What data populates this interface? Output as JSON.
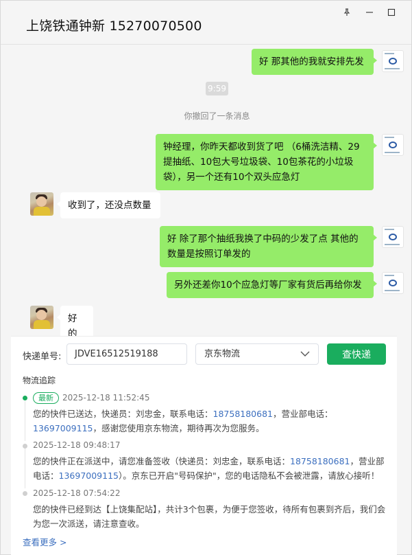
{
  "window": {
    "title": "上饶铁通钟新 15270070500",
    "controls": [
      "pin-icon",
      "minimize-icon",
      "maximize-icon"
    ]
  },
  "chat": {
    "time_chip": "9:59",
    "recall_notice": "你撤回了一条消息",
    "messages": [
      {
        "from": "me",
        "lines": [
          "好 那其他的我就安排先发"
        ]
      },
      {
        "from": "me",
        "lines": [
          "钟经理，你昨天都收到货了吧 （6桶洗洁精、29",
          "提抽纸、10包大号垃圾袋、10包茶花的小垃圾",
          "袋），另一个还有10个双头应急灯"
        ]
      },
      {
        "from": "other",
        "lines": [
          "收到了，还没点数量"
        ]
      },
      {
        "from": "me",
        "lines": [
          "好  除了那个抽纸我换了中码的少发了点 其他的",
          "数量是按照订单发的"
        ]
      },
      {
        "from": "me",
        "lines": [
          "另外还差你10个应急灯等厂家有货后再给你发"
        ]
      },
      {
        "from": "other",
        "lines": [
          "好的"
        ]
      }
    ]
  },
  "tracking": {
    "label_no": "快递单号:",
    "tracking_no": "JDVE16512519188",
    "carrier": "京东物流",
    "query_button": "查快递",
    "section_title": "物流追踪",
    "events": [
      {
        "badge": "最新",
        "time": "2025-12-18 11:52:45",
        "parts": [
          {
            "t": "您的快件已送达，快递员：刘忠金，联系电话：",
            "tel": false
          },
          {
            "t": "18758180681",
            "tel": true
          },
          {
            "t": "，营业部电话：",
            "tel": false
          },
          {
            "t": "13697009115",
            "tel": true
          },
          {
            "t": "，感谢您使用京东物流，期待再次为您服务。",
            "tel": false
          }
        ]
      },
      {
        "badge": "",
        "time": "2025-12-18 09:48:17",
        "parts": [
          {
            "t": "您的快件正在派送中，请您准备签收（快递员：刘忠金，联系电话：",
            "tel": false
          },
          {
            "t": "18758180681",
            "tel": true
          },
          {
            "t": "，营业部电话：",
            "tel": false
          },
          {
            "t": "13697009115",
            "tel": true
          },
          {
            "t": "）。京东已开启\"号码保护\"，您的电话隐私不会被泄露，请放心接听！",
            "tel": false
          }
        ]
      },
      {
        "badge": "",
        "time": "2025-12-18 07:54:22",
        "parts": [
          {
            "t": "您的快件已经到达【上饶集配站】，共计3个包裹，为便于您签收，待所有包裹到齐后，我们会为您一次派送，请注意查收。",
            "tel": false
          }
        ]
      }
    ],
    "more_link": "查看更多 >"
  },
  "colors": {
    "bubble_me": "#95ec69",
    "bubble_other": "#ffffff",
    "accent_green": "#1aad5e",
    "link_blue": "#3c6fbf"
  }
}
